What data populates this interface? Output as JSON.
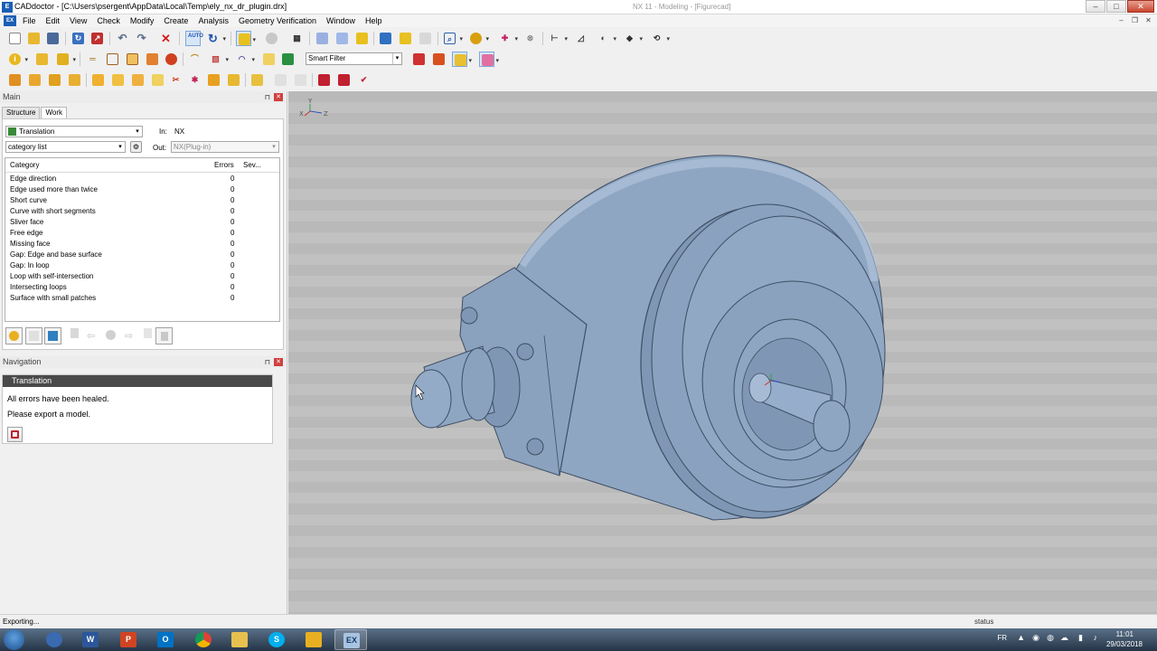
{
  "window": {
    "title": "CADdoctor - [C:\\Users\\psergent\\AppData\\Local\\Temp\\ely_nx_dr_plugin.drx]",
    "background_title": "NX 11 - Modeling - [Figurecad]",
    "caps": [
      "–",
      "□",
      "✕"
    ]
  },
  "menu": {
    "logo": "EX",
    "items": [
      "File",
      "Edit",
      "View",
      "Check",
      "Modify",
      "Create",
      "Analysis",
      "Geometry Verification",
      "Window",
      "Help"
    ],
    "mdi_caps": [
      "–",
      "❐",
      "✕"
    ]
  },
  "toolbar": {
    "smart_filter_value": "Smart Filter",
    "auto_label": "AUTO"
  },
  "main_panel": {
    "header": "Main",
    "pin": "⊓",
    "close": "✕",
    "tabs": [
      "Structure",
      "Work"
    ],
    "active_tab": "Work",
    "mode_select": "Translation",
    "list_select": "category list",
    "in_label": "In:",
    "in_value": "NX",
    "out_label": "Out:",
    "out_value": "NX(Plug-in)",
    "columns": [
      "Category",
      "Errors",
      "Sev..."
    ],
    "rows": [
      {
        "category": "Edge direction",
        "errors": "0"
      },
      {
        "category": "Edge used more than twice",
        "errors": "0"
      },
      {
        "category": "Short curve",
        "errors": "0"
      },
      {
        "category": "Curve with short segments",
        "errors": "0"
      },
      {
        "category": "Sliver face",
        "errors": "0"
      },
      {
        "category": "Free edge",
        "errors": "0"
      },
      {
        "category": "Missing face",
        "errors": "0"
      },
      {
        "category": "Gap: Edge and base surface",
        "errors": "0"
      },
      {
        "category": "Gap: In loop",
        "errors": "0"
      },
      {
        "category": "Loop with self-intersection",
        "errors": "0"
      },
      {
        "category": "Intersecting loops",
        "errors": "0"
      },
      {
        "category": "Surface with small patches",
        "errors": "0"
      }
    ]
  },
  "navigation": {
    "header": "Navigation",
    "section_title": "Translation",
    "messages": [
      "All errors have been healed.",
      "Please export a model."
    ]
  },
  "viewport": {
    "axis_labels": {
      "x": "X",
      "y": "Y",
      "z": "Z"
    }
  },
  "status": {
    "left": "Exporting...",
    "right": "status"
  },
  "taskbar": {
    "apps": [
      "IE",
      "W",
      "P",
      "O",
      "Chrome",
      "Explorer",
      "S",
      "NX",
      "EX"
    ],
    "lang": "FR",
    "time": "11:01",
    "date": "29/03/2018"
  },
  "colors": {
    "accent": "#1a5fb4",
    "model_body": "#8fa7c4",
    "viewport_band_a": "#b9b9b9",
    "viewport_band_b": "#c1c1c1"
  }
}
